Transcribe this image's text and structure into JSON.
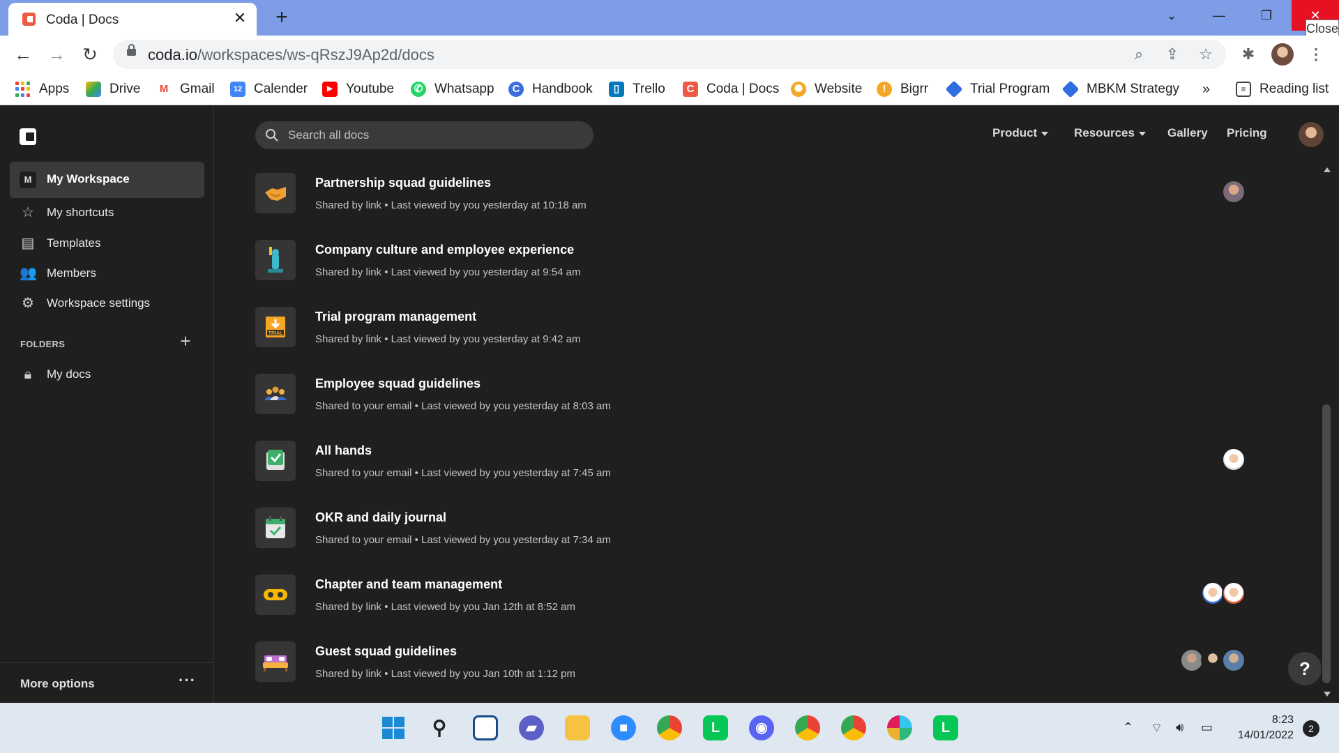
{
  "browser": {
    "tab_title": "Coda | Docs",
    "tooltip": "Close",
    "url_host": "coda.io",
    "url_path": "/workspaces/ws-qRszJ9Ap2d/docs"
  },
  "bookmarks": [
    {
      "label": "Apps",
      "icon": "apps-icon",
      "color": "#4285f4"
    },
    {
      "label": "Drive",
      "icon": "google-drive-icon",
      "color": "#0f9d58"
    },
    {
      "label": "Gmail",
      "icon": "gmail-icon",
      "color": "#ea4335"
    },
    {
      "label": "Calender",
      "icon": "calendar-icon",
      "color": "#4285f4"
    },
    {
      "label": "Youtube",
      "icon": "youtube-icon",
      "color": "#ff0000"
    },
    {
      "label": "Whatsapp",
      "icon": "whatsapp-icon",
      "color": "#25d366"
    },
    {
      "label": "Handbook",
      "icon": "handbook-icon",
      "color": "#3b6fe0"
    },
    {
      "label": "Trello",
      "icon": "trello-icon",
      "color": "#0079bf"
    },
    {
      "label": "Coda | Docs",
      "icon": "coda-icon",
      "color": "#ee5a46"
    },
    {
      "label": "Website",
      "icon": "website-icon",
      "color": "#f5a623"
    },
    {
      "label": "Bigrr",
      "icon": "bigrr-icon",
      "color": "#f5a623"
    },
    {
      "label": "Trial Program",
      "icon": "trial-program-icon",
      "color": "#2f6de1"
    },
    {
      "label": "MBKM Strategy",
      "icon": "mbkm-strategy-icon",
      "color": "#2f6de1"
    }
  ],
  "bookmarks_overflow": "»",
  "reading_list": "Reading list",
  "sidebar": {
    "workspace_initial": "M",
    "workspace": "My Workspace",
    "items": [
      {
        "label": "My shortcuts",
        "icon": "star-icon"
      },
      {
        "label": "Templates",
        "icon": "templates-icon"
      },
      {
        "label": "Members",
        "icon": "members-icon"
      },
      {
        "label": "Workspace settings",
        "icon": "gear-icon"
      }
    ],
    "folders_header": "FOLDERS",
    "folders": [
      {
        "label": "My docs",
        "icon": "lock-icon"
      }
    ],
    "more_options": "More options"
  },
  "header": {
    "search_placeholder": "Search all docs",
    "nav": [
      "Product",
      "Resources",
      "Gallery",
      "Pricing"
    ]
  },
  "docs": [
    {
      "title": "Partnership squad guidelines",
      "meta": "Shared by link • Last viewed by you yesterday at 10:18 am",
      "icon": "handshake-icon",
      "avatars": 1
    },
    {
      "title": "Company culture and employee experience",
      "meta": "Shared by link • Last viewed by you yesterday at 9:54 am",
      "icon": "statue-of-liberty-icon",
      "avatars": 0
    },
    {
      "title": "Trial program management",
      "meta": "Shared by link • Last viewed by you yesterday at 9:42 am",
      "icon": "trial-icon",
      "avatars": 0
    },
    {
      "title": "Employee squad guidelines",
      "meta": "Shared to your email • Last viewed by you yesterday at 8:03 am",
      "icon": "team-icon",
      "avatars": 0
    },
    {
      "title": "All hands",
      "meta": "Shared to your email • Last viewed by you yesterday at 7:45 am",
      "icon": "checkbox-icon",
      "avatars": 1
    },
    {
      "title": "OKR and daily journal",
      "meta": "Shared to your email • Last viewed by you yesterday at 7:34 am",
      "icon": "calendar-check-icon",
      "avatars": 0
    },
    {
      "title": "Chapter and team management",
      "meta": "Shared by link • Last viewed by you Jan 12th at 8:52 am",
      "icon": "infinity-icon",
      "avatars": 2
    },
    {
      "title": "Guest squad guidelines",
      "meta": "Shared by link • Last viewed by you Jan 10th at 1:12 pm",
      "icon": "bed-icon",
      "avatars": 3
    }
  ],
  "help": "?",
  "taskbar": {
    "time": "8:23",
    "date": "14/01/2022",
    "notifications": "2"
  },
  "colors": {
    "accent_coda": "#ee5a46",
    "bg": "#1f1f1f",
    "sidebar_selected": "#3a3a3a"
  }
}
